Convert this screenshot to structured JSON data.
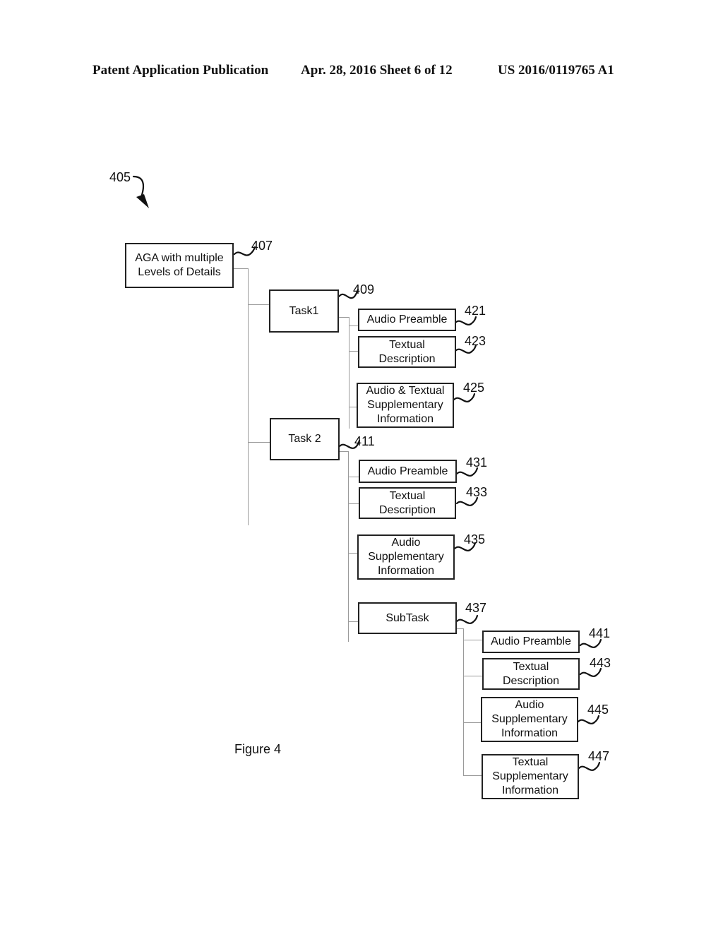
{
  "header": {
    "publication": "Patent Application Publication",
    "date_sheet": "Apr. 28, 2016  Sheet 6 of 12",
    "patent_number": "US 2016/0119765 A1"
  },
  "figure": {
    "label": "Figure 4",
    "ref": "405"
  },
  "nodes": {
    "root": {
      "text": "AGA with multiple\nLevels of Details",
      "ref": "407"
    },
    "task1": {
      "text": "Task1",
      "ref": "409"
    },
    "t1_audio_preamble": {
      "text": "Audio Preamble",
      "ref": "421"
    },
    "t1_textual_description": {
      "text": "Textual\nDescription",
      "ref": "423"
    },
    "t1_supplementary": {
      "text": "Audio & Textual\nSupplementary\nInformation",
      "ref": "425"
    },
    "task2": {
      "text": "Task 2",
      "ref": "411"
    },
    "t2_audio_preamble": {
      "text": "Audio Preamble",
      "ref": "431"
    },
    "t2_textual_description": {
      "text": "Textual\nDescription",
      "ref": "433"
    },
    "t2_audio_supplementary": {
      "text": "Audio\nSupplementary\nInformation",
      "ref": "435"
    },
    "subtask": {
      "text": "SubTask",
      "ref": "437"
    },
    "st_audio_preamble": {
      "text": "Audio Preamble",
      "ref": "441"
    },
    "st_textual_description": {
      "text": "Textual\nDescription",
      "ref": "443"
    },
    "st_audio_supplementary": {
      "text": "Audio\nSupplementary\nInformation",
      "ref": "445"
    },
    "st_textual_supplementary": {
      "text": "Textual\nSupplementary\nInformation",
      "ref": "447"
    }
  }
}
